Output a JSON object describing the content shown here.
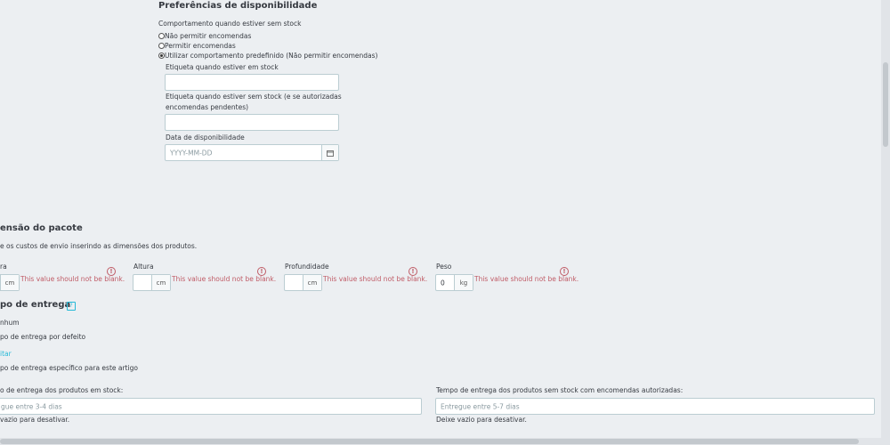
{
  "availability": {
    "title": "Preferências de disponibilidade",
    "behavior_label": "Comportamento quando estiver sem stock",
    "options": [
      {
        "label": "Não permitir encomendas",
        "selected": false
      },
      {
        "label": "Permitir encomendas",
        "selected": false
      },
      {
        "label": "Utilizar comportamento predefinido (Não permitir encomendas)",
        "selected": true
      }
    ],
    "label_in_stock": "Etiqueta quando estiver em stock",
    "label_in_stock_value": "",
    "label_out_stock_line1": "Etiqueta quando estiver sem stock (e se autorizadas",
    "label_out_stock_line2": "encomendas pendentes)",
    "label_out_stock_value": "",
    "availability_date_label": "Data de disponibilidade",
    "availability_date_placeholder": "YYYY-MM-DD",
    "calendar_icon": "calendar-icon"
  },
  "package": {
    "title": "ensão do pacote",
    "description": "e os custos de envio inserindo as dimensões dos produtos.",
    "fields": [
      {
        "label": "ra",
        "value": "",
        "unit": "cm",
        "error": "This value should not be blank."
      },
      {
        "label": "Altura",
        "value": "",
        "unit": "cm",
        "error": "This value should not be blank."
      },
      {
        "label": "Profundidade",
        "value": "",
        "unit": "cm",
        "error": "This value should not be blank."
      },
      {
        "label": "Peso",
        "value": "0",
        "unit": "kg",
        "error": "This value should not be blank."
      }
    ],
    "error_icon": "!"
  },
  "delivery": {
    "title": "po de entrega",
    "help_icon": "?",
    "options": [
      {
        "label": "nhum"
      },
      {
        "label": "po de entrega por defeito"
      },
      {
        "label": "po de entrega específico para este artigo"
      }
    ],
    "edit_link": "itar",
    "in_stock_label": "o de entrega dos produtos em stock:",
    "in_stock_placeholder": "gue entre 3-4 dias",
    "in_stock_hint": "vazio para desativar.",
    "out_stock_label": "Tempo de entrega dos produtos sem stock com encomendas autorizadas:",
    "out_stock_placeholder": "Entregue entre 5-7 dias",
    "out_stock_hint": "Deixe vazio para desativar."
  }
}
